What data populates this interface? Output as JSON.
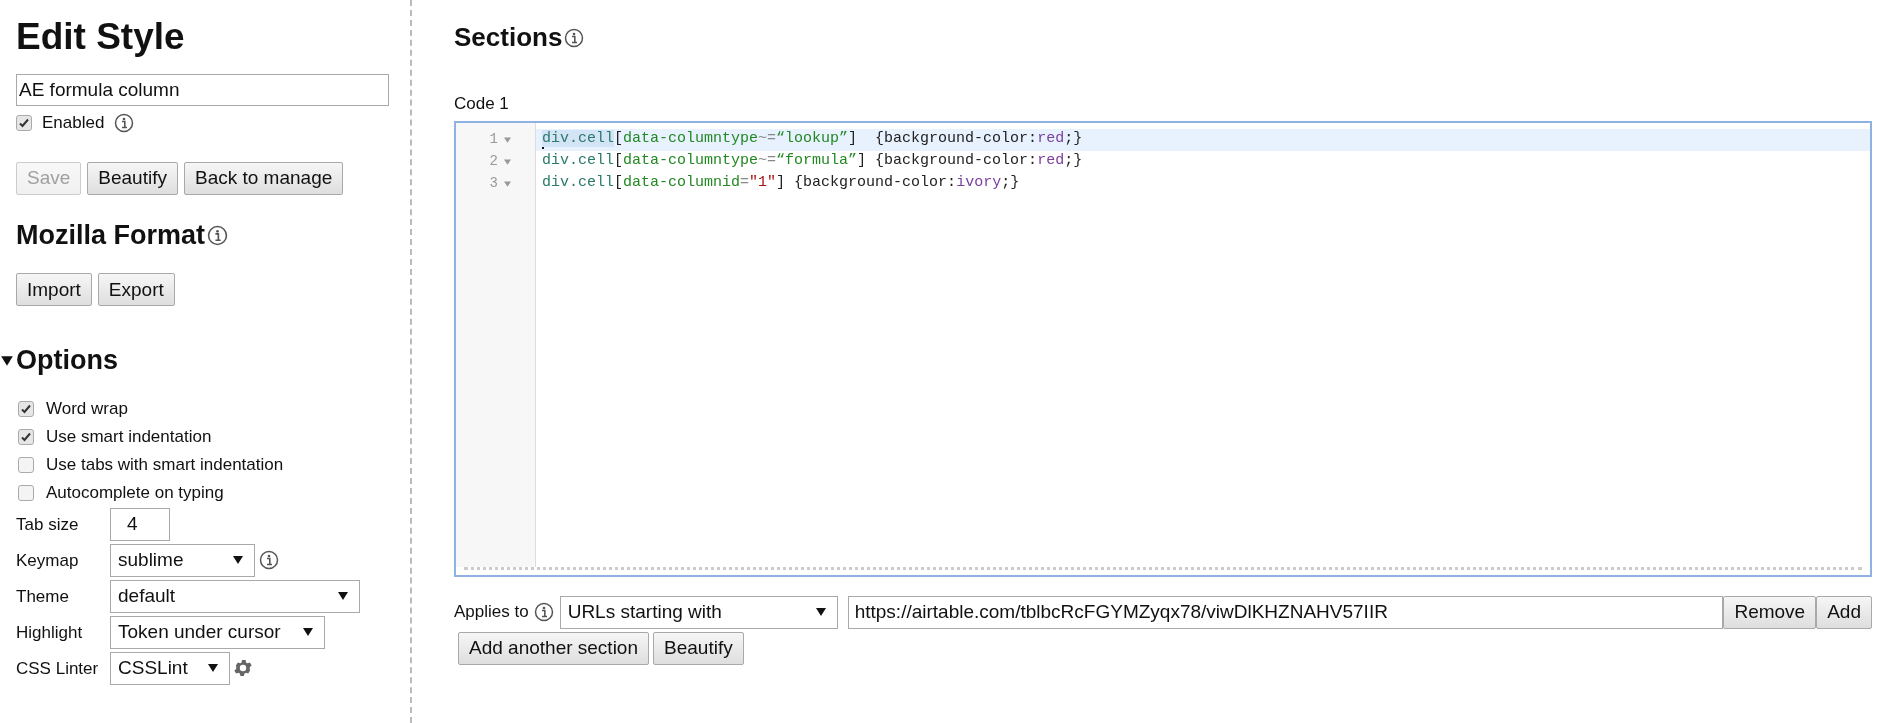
{
  "sidebar": {
    "title": "Edit Style",
    "name_field": {
      "value": "AE formula column"
    },
    "enabled": {
      "label": "Enabled",
      "checked": true
    },
    "buttons": [
      {
        "label": "Save",
        "disabled": true
      },
      {
        "label": "Beautify",
        "disabled": false
      },
      {
        "label": "Back to manage",
        "disabled": false
      }
    ],
    "mozilla_format": {
      "title": "Mozilla Format",
      "buttons": [
        "Import",
        "Export"
      ]
    },
    "options": {
      "title": "Options",
      "expanded": true,
      "checkboxes": [
        {
          "label": "Word wrap",
          "checked": true
        },
        {
          "label": "Use smart indentation",
          "checked": true
        },
        {
          "label": "Use tabs with smart indentation",
          "checked": false
        },
        {
          "label": "Autocomplete on typing",
          "checked": false
        }
      ],
      "settings": [
        {
          "kind": "input",
          "label": "Tab size",
          "value": "4"
        },
        {
          "kind": "select",
          "label": "Keymap",
          "value": "sublime"
        },
        {
          "kind": "select",
          "label": "Theme",
          "value": "default"
        },
        {
          "kind": "select",
          "label": "Highlight",
          "value": "Token under cursor"
        },
        {
          "kind": "select",
          "label": "CSS Linter",
          "value": "CSSLint"
        }
      ]
    }
  },
  "main": {
    "title": "Sections",
    "section": {
      "label": "Code 1",
      "lines": [
        {
          "number": "1",
          "active": true,
          "tokens": [
            {
              "kind": "tag",
              "text": "div.cell",
              "highlighted": true
            },
            {
              "kind": "plain",
              "text": "["
            },
            {
              "kind": "attribute",
              "text": "data-columntype"
            },
            {
              "kind": "operator",
              "text": "~="
            },
            {
              "kind": "attribute",
              "text": "“lookup”"
            },
            {
              "kind": "plain",
              "text": "]  {background-color:"
            },
            {
              "kind": "keyword",
              "text": "red"
            },
            {
              "kind": "plain",
              "text": ";}"
            }
          ]
        },
        {
          "number": "2",
          "active": false,
          "tokens": [
            {
              "kind": "tag",
              "text": "div.cell",
              "highlighted": false
            },
            {
              "kind": "plain",
              "text": "["
            },
            {
              "kind": "attribute",
              "text": "data-columntype"
            },
            {
              "kind": "operator",
              "text": "~="
            },
            {
              "kind": "attribute",
              "text": "“formula”"
            },
            {
              "kind": "plain",
              "text": "] {background-color:"
            },
            {
              "kind": "keyword",
              "text": "red"
            },
            {
              "kind": "plain",
              "text": ";}"
            }
          ]
        },
        {
          "number": "3",
          "active": false,
          "tokens": [
            {
              "kind": "tag",
              "text": "div.cell",
              "highlighted": false
            },
            {
              "kind": "plain",
              "text": "["
            },
            {
              "kind": "attribute",
              "text": "data-columnid"
            },
            {
              "kind": "operator",
              "text": "="
            },
            {
              "kind": "string",
              "text": "\"1\""
            },
            {
              "kind": "plain",
              "text": "] {background-color:"
            },
            {
              "kind": "keyword",
              "text": "ivory"
            },
            {
              "kind": "plain",
              "text": ";}"
            }
          ]
        }
      ],
      "applies_label": "Applies to",
      "match_type": "URLs starting with",
      "url": "https://airtable.com/tblbcRcFGYMZyqx78/viwDlKHZNAHV57IIR",
      "row_buttons": [
        "Remove",
        "Add"
      ]
    },
    "bottom_buttons": [
      "Add another section",
      "Beautify"
    ]
  }
}
